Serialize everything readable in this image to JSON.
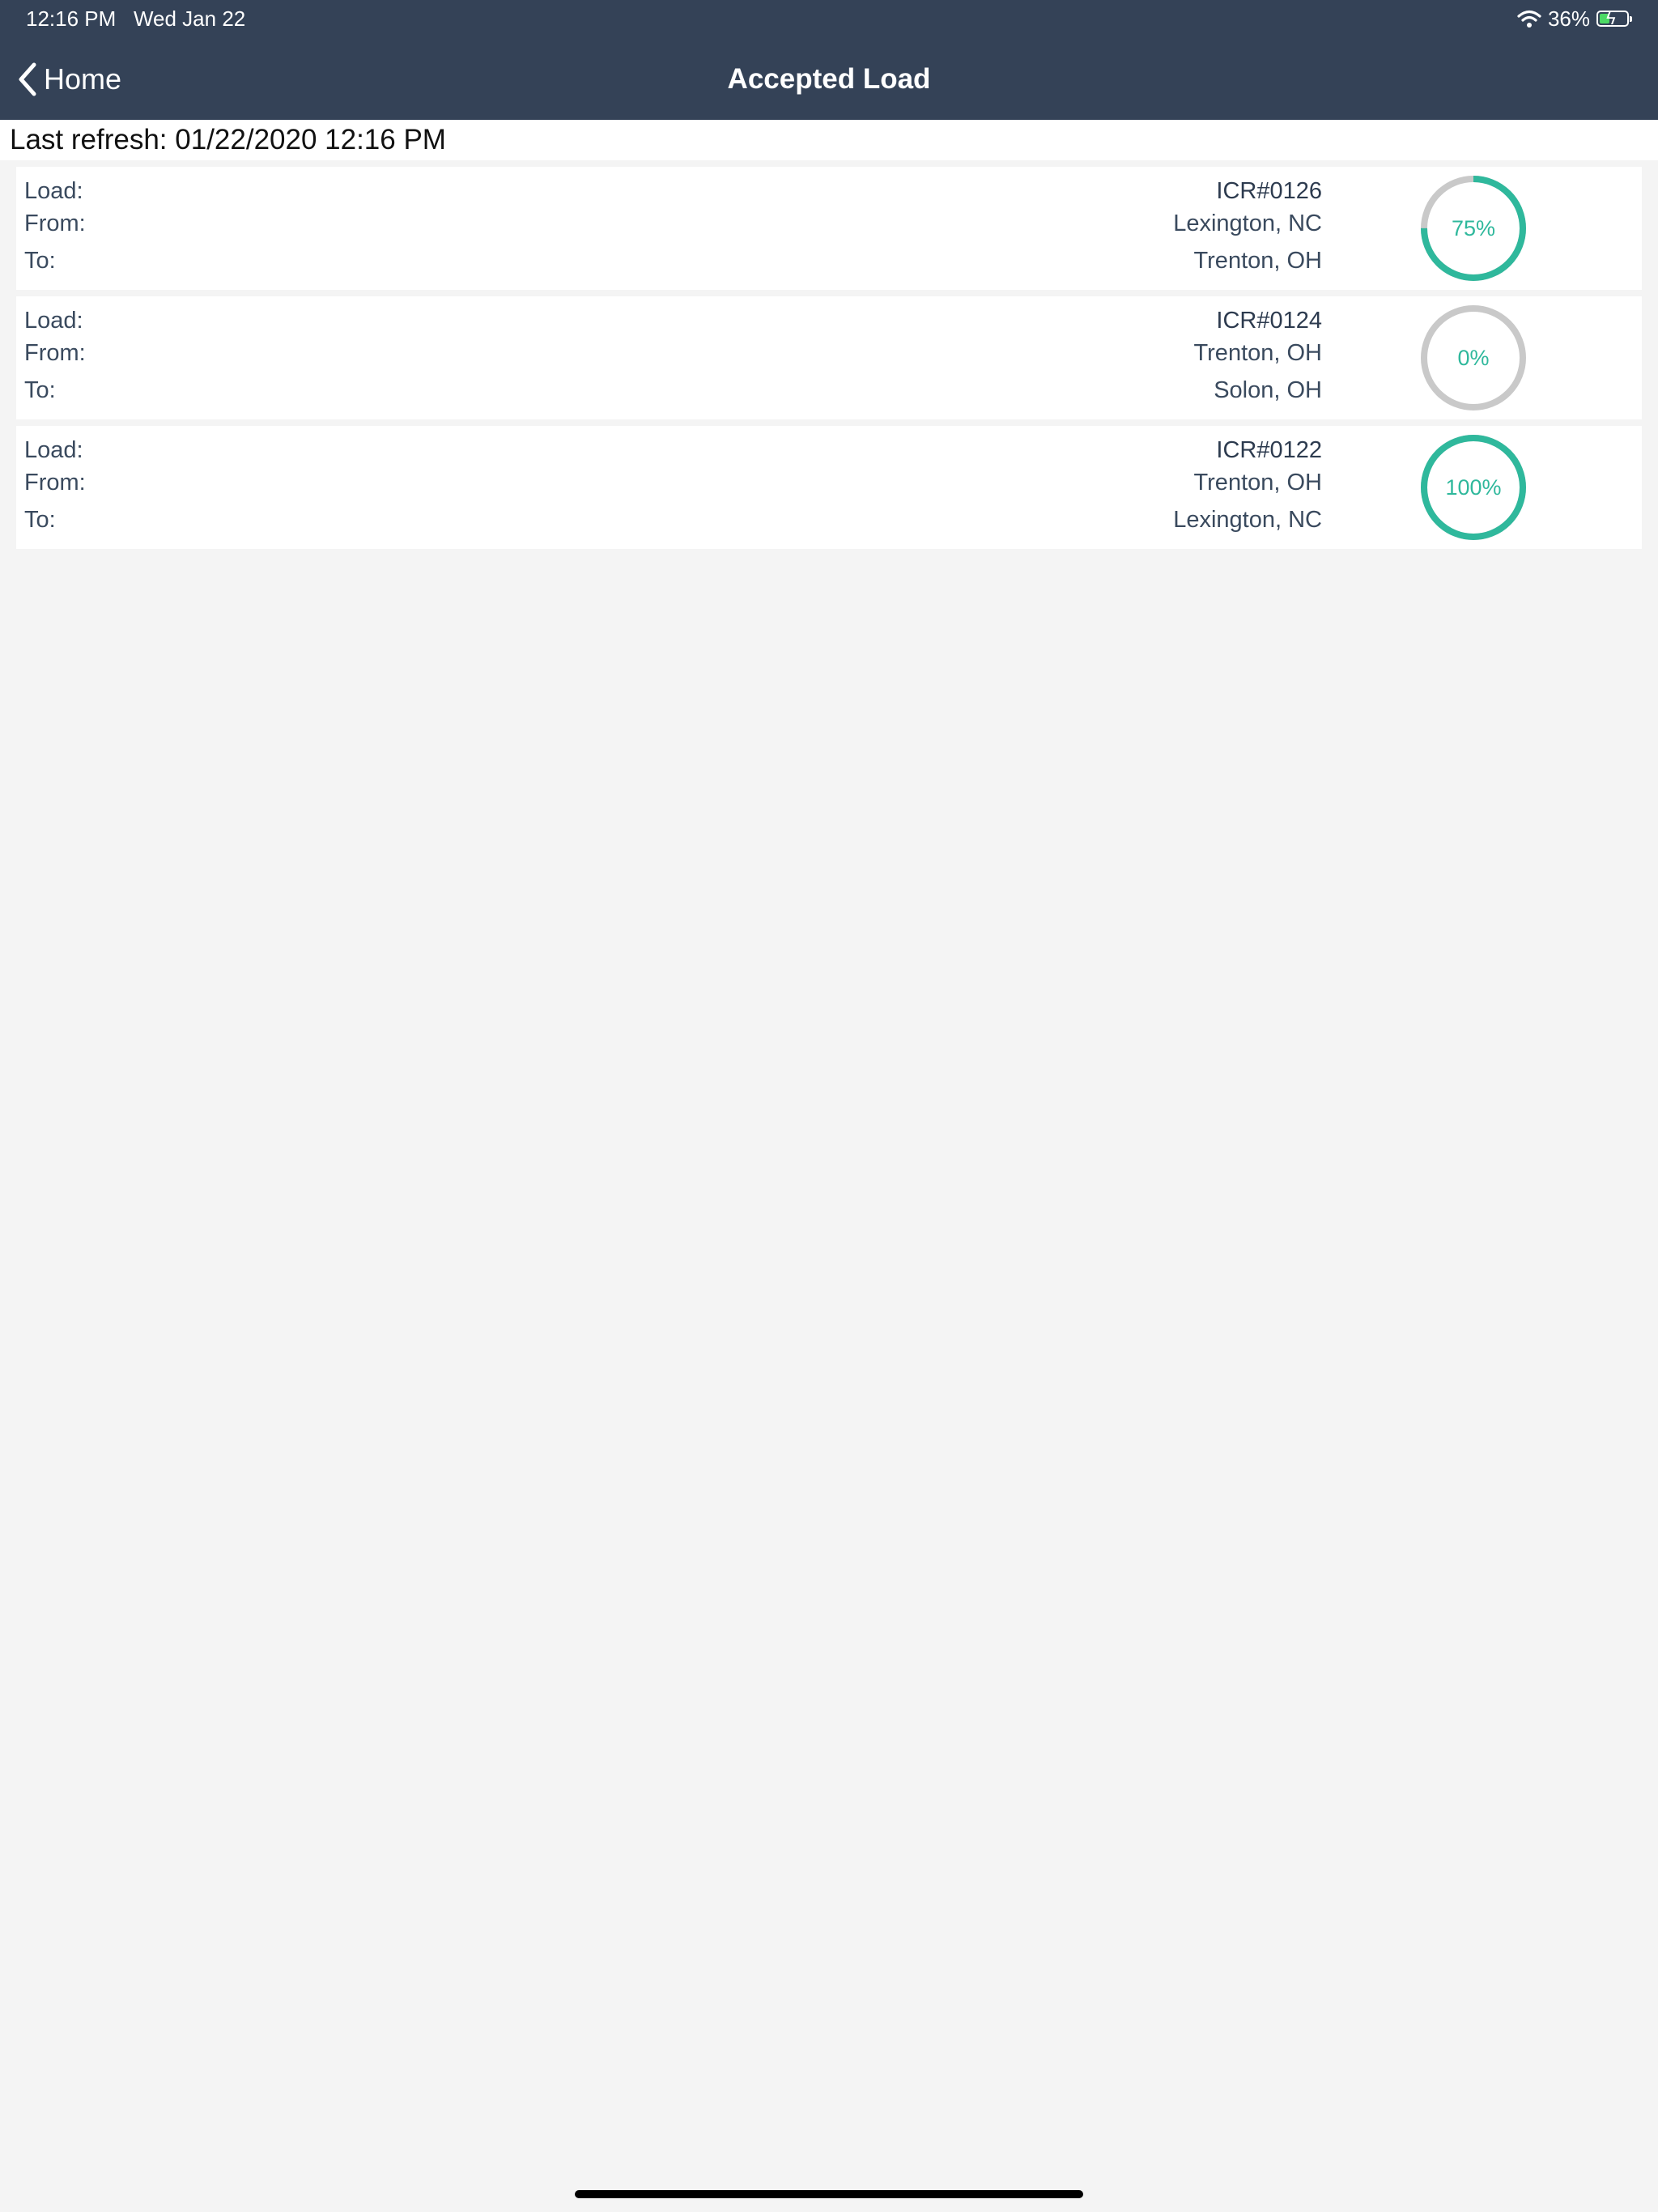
{
  "status_bar": {
    "time_date": "12:16 PM   Wed Jan 22",
    "battery_text": "36%",
    "battery_level": 0.36,
    "battery_fill_color": "#4cd964",
    "icons": [
      "wifi-icon",
      "battery-charging-icon"
    ]
  },
  "nav": {
    "back_label": "Home",
    "title": "Accepted Load",
    "background": "#344257"
  },
  "refresh": {
    "text": "Last refresh: 01/22/2020 12:16 PM"
  },
  "labels": {
    "load": "Load:",
    "from": "From:",
    "to": "To:"
  },
  "colors": {
    "progress": "#2fb89c",
    "track": "#c9c9c9"
  },
  "loads": [
    {
      "load": "ICR#0126",
      "from": "Lexington, NC",
      "to": "Trenton, OH",
      "progress": 75,
      "progress_label": "75%"
    },
    {
      "load": "ICR#0124",
      "from": "Trenton, OH",
      "to": "Solon, OH",
      "progress": 0,
      "progress_label": "0%"
    },
    {
      "load": "ICR#0122",
      "from": "Trenton, OH",
      "to": "Lexington, NC",
      "progress": 100,
      "progress_label": "100%"
    }
  ]
}
